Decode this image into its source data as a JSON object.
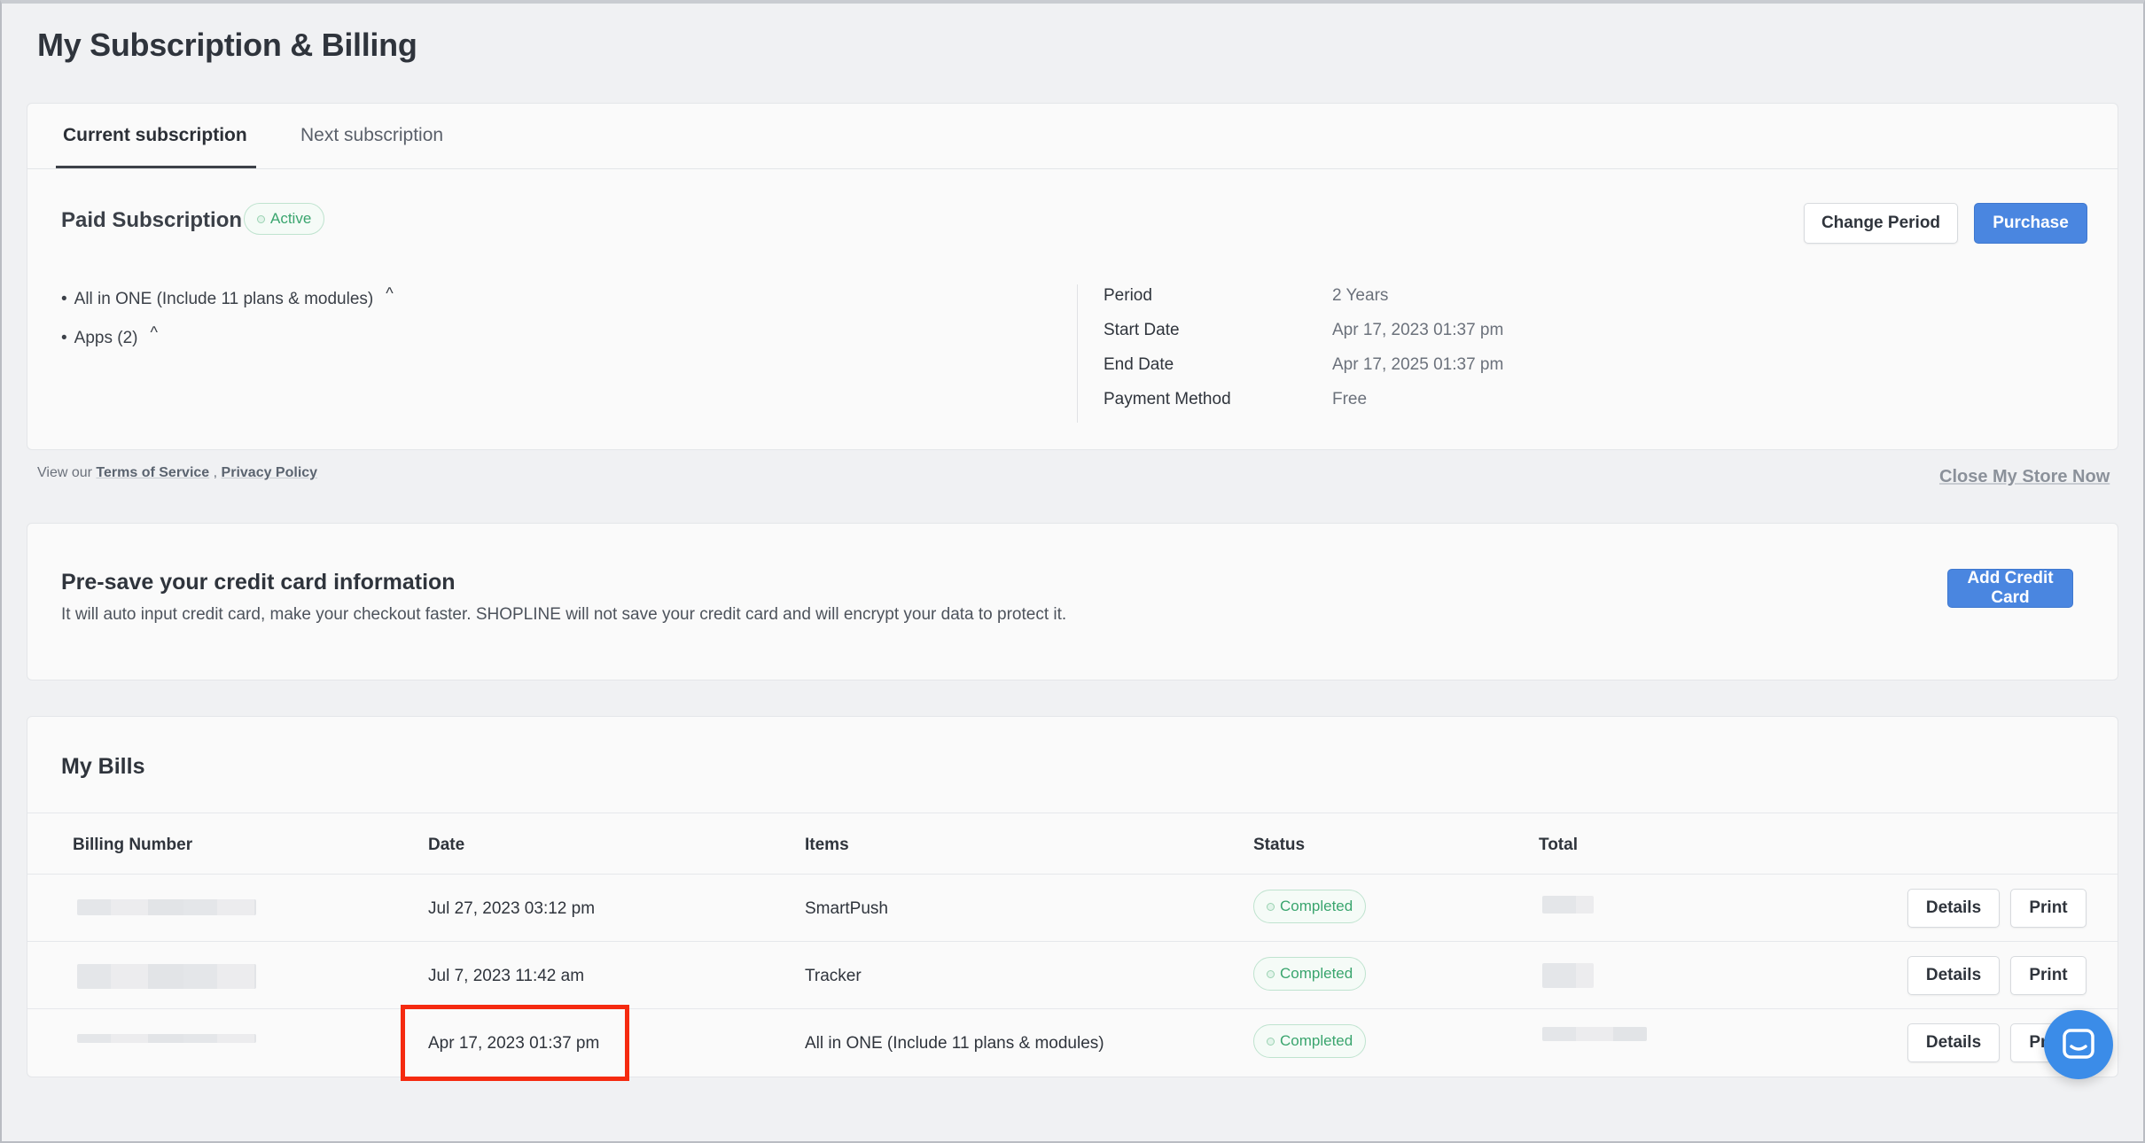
{
  "page": {
    "title": "My Subscription & Billing"
  },
  "tabs": [
    {
      "label": "Current subscription",
      "active": true
    },
    {
      "label": "Next subscription",
      "active": false
    }
  ],
  "subscription": {
    "title": "Paid Subscription",
    "status": "Active",
    "plans": [
      {
        "label": "All in ONE (Include 11 plans & modules)"
      },
      {
        "label": "Apps (2)"
      }
    ],
    "details": [
      {
        "label": "Period",
        "value": "2 Years"
      },
      {
        "label": "Start Date",
        "value": "Apr 17, 2023 01:37 pm"
      },
      {
        "label": "End Date",
        "value": "Apr 17, 2025 01:37 pm"
      },
      {
        "label": "Payment Method",
        "value": "Free"
      }
    ],
    "buttons": {
      "change_period": "Change Period",
      "purchase": "Purchase"
    }
  },
  "footer": {
    "view_our": "View our",
    "terms": "Terms of Service",
    "separator": ",",
    "privacy": "Privacy Policy",
    "close_store": "Close My Store Now"
  },
  "credit_card": {
    "title": "Pre-save your credit card information",
    "description": "It will auto input credit card, make your checkout faster. SHOPLINE will not save your credit card and will encrypt your data to protect it.",
    "button": "Add Credit Card"
  },
  "bills": {
    "title": "My Bills",
    "columns": {
      "billing_number": "Billing Number",
      "date": "Date",
      "items": "Items",
      "status": "Status",
      "total": "Total"
    },
    "rows": [
      {
        "date": "Jul 27, 2023 03:12 pm",
        "item": "SmartPush",
        "status": "Completed",
        "details": "Details",
        "print": "Print"
      },
      {
        "date": "Jul 7, 2023 11:42 am",
        "item": "Tracker",
        "status": "Completed",
        "details": "Details",
        "print": "Print"
      },
      {
        "date": "Apr 17, 2023 01:37 pm",
        "item": "All in ONE (Include 11 plans & modules)",
        "status": "Completed",
        "details": "Details",
        "print": "Print"
      }
    ]
  },
  "colors": {
    "accent_blue": "#4a86e0",
    "status_green": "#3aa56e",
    "highlight_red": "#f52a10",
    "chat_button": "#3b8ce8"
  },
  "icons": {
    "chat": "chat-bubble-icon",
    "caret": "caret-up-icon"
  }
}
